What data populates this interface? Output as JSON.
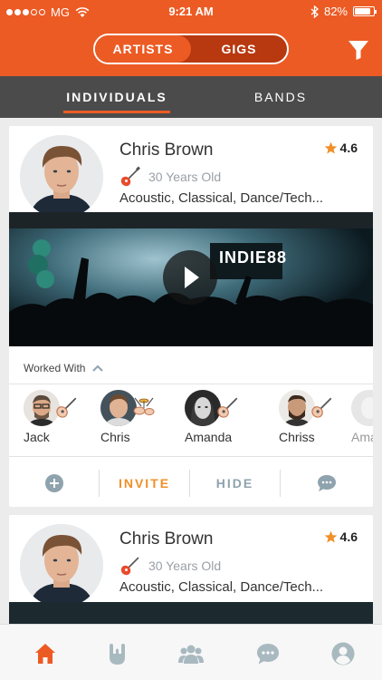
{
  "status_bar": {
    "carrier": "MG",
    "time": "9:21 AM",
    "battery": "82%"
  },
  "header": {
    "segments": [
      "ARTISTS",
      "GIGS"
    ],
    "active_segment": "ARTISTS"
  },
  "tabs": [
    "INDIVIDUALS",
    "BANDS"
  ],
  "cards": [
    {
      "name": "Chris Brown",
      "rating": "4.6",
      "age": "30 Years Old",
      "genres": "Acoustic, Classical, Dance/Tech...",
      "video_banner": "INDIE88",
      "worked_with_label": "Worked With",
      "collaborators": [
        {
          "name": "Jack",
          "instrument": "guitar-icon"
        },
        {
          "name": "Chris",
          "instrument": "drums-icon"
        },
        {
          "name": "Amanda",
          "instrument": "guitar-icon"
        },
        {
          "name": "Chriss",
          "instrument": "guitar-icon"
        },
        {
          "name": "Ama",
          "instrument": "guitar-icon"
        }
      ],
      "actions": {
        "invite": "INVITE",
        "hide": "HIDE"
      }
    },
    {
      "name": "Chris Brown",
      "rating": "4.6",
      "age": "30 Years Old",
      "genres": "Acoustic, Classical, Dance/Tech..."
    }
  ],
  "colors": {
    "brand": "#ec5b24",
    "tabbar": "#4b4b4b",
    "star": "#f0902a",
    "invite": "#f0902a",
    "muted": "#8ea3ad"
  },
  "bottom_nav": [
    "home-icon",
    "rock-hand-icon",
    "group-icon",
    "chat-icon",
    "profile-icon"
  ]
}
